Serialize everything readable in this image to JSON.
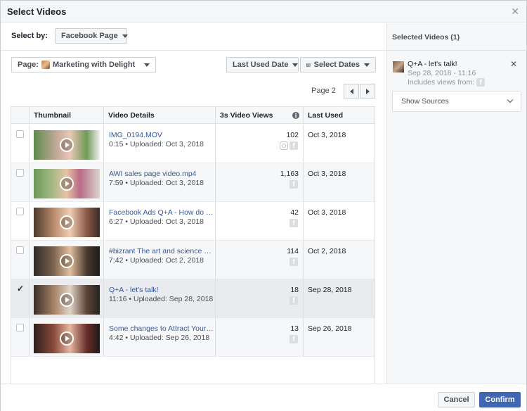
{
  "header": {
    "title": "Select Videos"
  },
  "toolbar": {
    "select_by_label": "Select by:",
    "select_by_value": "Facebook Page",
    "page_label": "Page:",
    "page_value": "Marketing with Delight",
    "last_used_date": "Last Used Date",
    "select_dates": "Select Dates"
  },
  "pager": {
    "label": "Page 2"
  },
  "table": {
    "columns": {
      "thumbnail": "Thumbnail",
      "details": "Video Details",
      "views": "3s Video Views",
      "last_used": "Last Used"
    },
    "rows": [
      {
        "title": "IMG_0194.MOV",
        "meta": "0:15 • Uploaded: Oct 3, 2018",
        "views": "102",
        "last_used": "Oct 3, 2018",
        "checked": false,
        "sources": [
          "instagram",
          "facebook"
        ]
      },
      {
        "title": "AWI sales page video.mp4",
        "meta": "7:59 • Uploaded: Oct 3, 2018",
        "views": "1,163",
        "last_used": "Oct 3, 2018",
        "checked": false,
        "sources": [
          "facebook"
        ]
      },
      {
        "title": "Facebook Ads Q+A - How do I …",
        "meta": "6:27 • Uploaded: Oct 3, 2018",
        "views": "42",
        "last_used": "Oct 3, 2018",
        "checked": false,
        "sources": [
          "facebook"
        ]
      },
      {
        "title": "#bizrant The art and science of…",
        "meta": "7:42 • Uploaded: Oct 2, 2018",
        "views": "114",
        "last_used": "Oct 2, 2018",
        "checked": false,
        "sources": [
          "facebook"
        ]
      },
      {
        "title": "Q+A - let's talk!",
        "meta": "11:16 • Uploaded: Sep 28, 2018",
        "views": "18",
        "last_used": "Sep 28, 2018",
        "checked": true,
        "sources": [
          "facebook"
        ]
      },
      {
        "title": "Some changes to Attract Your …",
        "meta": "4:42 • Uploaded: Sep 26, 2018",
        "views": "13",
        "last_used": "Sep 26, 2018",
        "checked": false,
        "sources": [
          "facebook"
        ]
      }
    ]
  },
  "selected": {
    "title": "Selected Videos (1)",
    "item": {
      "name": "Q+A - let's talk!",
      "date": "Sep 28, 2018 - 11:16",
      "views_label": "Includes views from:"
    },
    "show_sources": "Show Sources"
  },
  "footer": {
    "cancel": "Cancel",
    "confirm": "Confirm"
  },
  "colors": {
    "accent": "#4267b2",
    "link": "#365899"
  }
}
